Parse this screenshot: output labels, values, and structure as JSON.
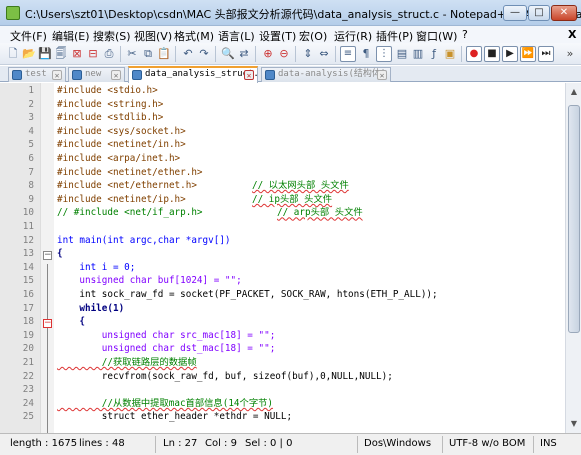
{
  "window": {
    "title": "C:\\Users\\szt01\\Desktop\\csdn\\MAC 头部报文分析源代码\\data_analysis_struct.c - Notepad++ [Administrator]",
    "controls": [
      "—",
      "□",
      "✕"
    ]
  },
  "menu": [
    "文件(F)",
    "编辑(E)",
    "搜索(S)",
    "视图(V)",
    "格式(M)",
    "语言(L)",
    "设置(T)",
    "宏(O)",
    "运行(R)",
    "插件(P)",
    "窗口(W)",
    "?",
    "X"
  ],
  "toolbar_icons": [
    "new-file-icon",
    "open-file-icon",
    "save-icon",
    "save-all-icon",
    "close-icon",
    "close-all-icon",
    "print-icon",
    "cut-icon",
    "copy-icon",
    "paste-icon",
    "undo-icon",
    "redo-icon",
    "find-icon",
    "replace-icon",
    "zoom-in-icon",
    "zoom-out-icon",
    "sync-v-icon",
    "sync-h-icon",
    "word-wrap-icon",
    "show-all-chars-icon",
    "indent-guide-icon",
    "udl-icon",
    "doc-map-icon",
    "function-list-icon",
    "folder-workspace-icon",
    "record-macro-icon",
    "stop-record-icon",
    "play-macro-icon",
    "play-multiple-icon",
    "save-macro-icon"
  ],
  "tabs": [
    {
      "label": "test",
      "active": false
    },
    {
      "label": "new",
      "active": false
    },
    {
      "label": "data_analysis_struct.",
      "active": true
    },
    {
      "label": "data-analysis(结构体)",
      "active": false
    }
  ],
  "code_lines": [
    {
      "n": "1",
      "t": "#include <stdio.h>"
    },
    {
      "n": "2",
      "t": "#include <string.h>"
    },
    {
      "n": "3",
      "t": "#include <stdlib.h>"
    },
    {
      "n": "4",
      "t": "#include <sys/socket.h>"
    },
    {
      "n": "5",
      "t": "#include <netinet/in.h>"
    },
    {
      "n": "6",
      "t": "#include <arpa/inet.h>"
    },
    {
      "n": "7",
      "t": "#include <netinet/ether.h>"
    },
    {
      "n": "8",
      "t": "#include <net/ethernet.h>",
      "c": "// 以太网头部 头文件"
    },
    {
      "n": "9",
      "t": "#include <netinet/ip.h>",
      "c": "// ip头部 头文件"
    },
    {
      "n": "10",
      "t": "// #include <net/if_arp.h>",
      "c": "// arp头部 头文件"
    },
    {
      "n": "11",
      "t": ""
    },
    {
      "n": "12",
      "t": "int main(int argc,char *argv[])"
    },
    {
      "n": "13",
      "t": "{"
    },
    {
      "n": "14",
      "t": "    int i = 0;"
    },
    {
      "n": "15",
      "t": "    unsigned char buf[1024] = \"\";"
    },
    {
      "n": "16",
      "t": "    int sock_raw_fd = socket(PF_PACKET, SOCK_RAW, htons(ETH_P_ALL));"
    },
    {
      "n": "17",
      "t": "    while(1)"
    },
    {
      "n": "18",
      "t": "    {"
    },
    {
      "n": "19",
      "t": "        unsigned char src_mac[18] = \"\";"
    },
    {
      "n": "20",
      "t": "        unsigned char dst_mac[18] = \"\";"
    },
    {
      "n": "21",
      "t": "        //获取链路层的数据帧"
    },
    {
      "n": "22",
      "t": "        recvfrom(sock_raw_fd, buf, sizeof(buf),0,NULL,NULL);"
    },
    {
      "n": "23",
      "t": ""
    },
    {
      "n": "24",
      "t": "        //从数据中提取mac首部信息(14个字节)"
    },
    {
      "n": "25",
      "t": "        struct ether_header *ethdr = NULL;"
    }
  ],
  "status": {
    "length": "length : 1675",
    "lines": "lines : 48",
    "ln": "Ln : 27",
    "col": "Col : 9",
    "sel": "Sel : 0 | 0",
    "eol": "Dos\\Windows",
    "encoding": "UTF-8 w/o BOM",
    "mode": "INS"
  }
}
